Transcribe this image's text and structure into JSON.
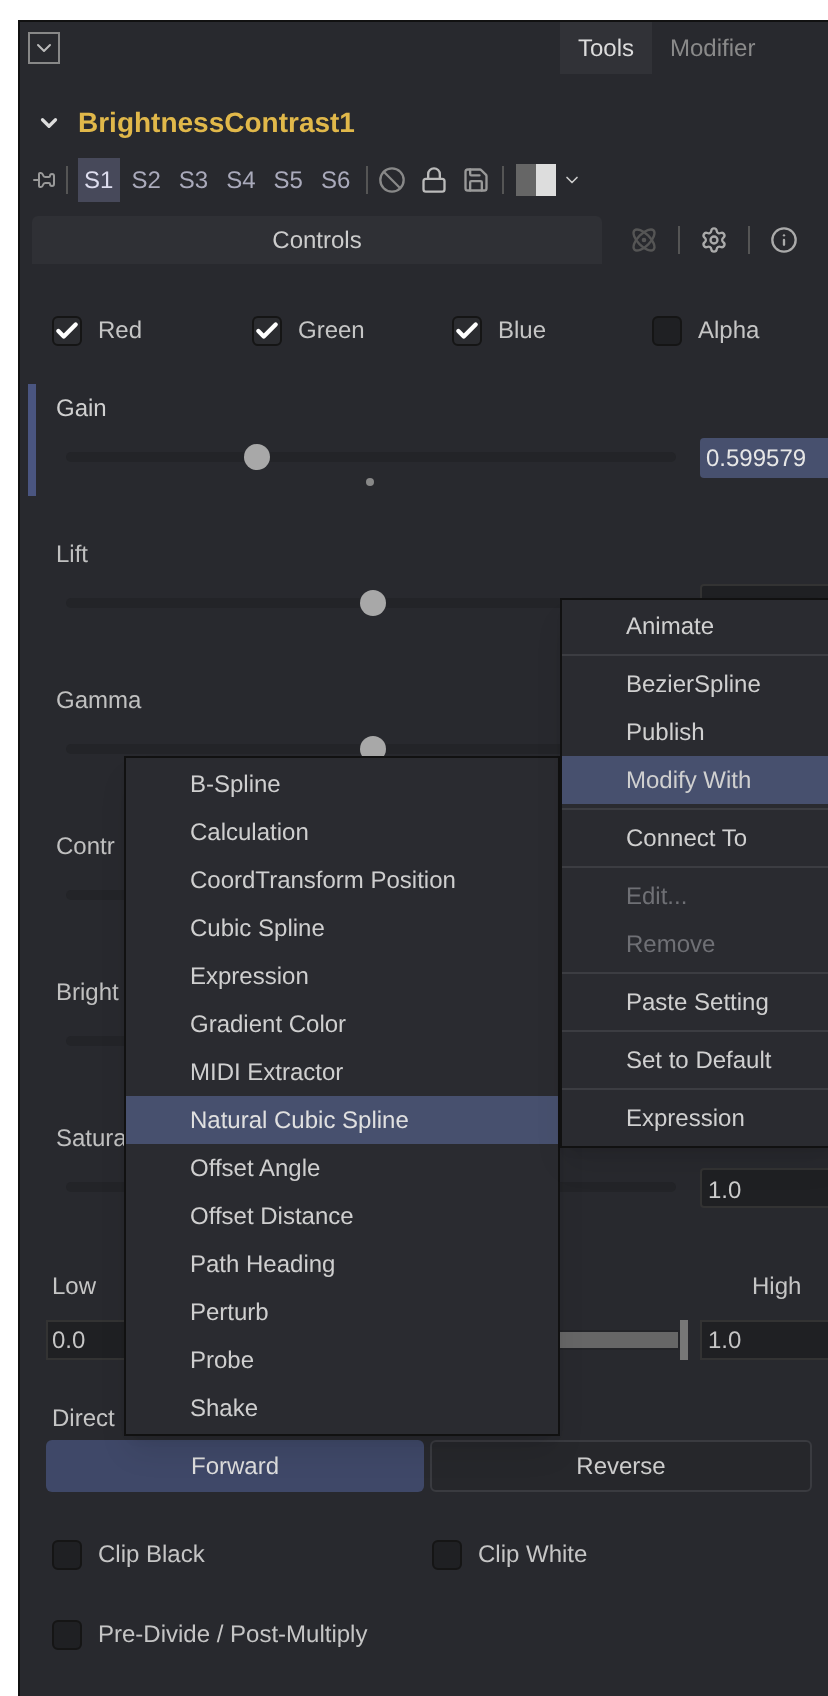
{
  "header": {
    "tabs": [
      {
        "label": "Tools",
        "selected": true
      },
      {
        "label": "Modifier",
        "selected": false
      }
    ]
  },
  "tool": {
    "name": "BrightnessContrast1",
    "expanded": true
  },
  "toolbar": {
    "versions": [
      {
        "label": "S1",
        "selected": true
      },
      {
        "label": "S2",
        "selected": false
      },
      {
        "label": "S3",
        "selected": false
      },
      {
        "label": "S4",
        "selected": false
      },
      {
        "label": "S5",
        "selected": false
      },
      {
        "label": "S6",
        "selected": false
      }
    ]
  },
  "panel_tab": {
    "label": "Controls"
  },
  "channels": [
    {
      "label": "Red",
      "checked": true
    },
    {
      "label": "Green",
      "checked": true
    },
    {
      "label": "Blue",
      "checked": true
    },
    {
      "label": "Alpha",
      "checked": false
    }
  ],
  "sliders": [
    {
      "label": "Gain",
      "level": 0.31,
      "value": "0.599579",
      "active": true
    },
    {
      "label": "Lift",
      "level": 0.5,
      "active": false
    },
    {
      "label": "Gamma",
      "level": 0.5,
      "active": false
    },
    {
      "label": "Contr",
      "active": false
    },
    {
      "label": "Bright",
      "active": false
    },
    {
      "label": "Satura",
      "value": "1.0",
      "active": false
    }
  ],
  "range": {
    "low_label": "Low",
    "high_label": "High",
    "low_value": "0.0",
    "high_value": "1.0",
    "level": 1
  },
  "direction": {
    "label": "Direct",
    "options": [
      {
        "label": "Forward",
        "selected": true
      },
      {
        "label": "Reverse",
        "selected": false
      }
    ]
  },
  "options": [
    {
      "label": "Clip Black",
      "checked": false
    },
    {
      "label": "Clip White",
      "checked": false
    },
    {
      "label": "Pre-Divide / Post-Multiply",
      "checked": false
    }
  ],
  "context_menu": {
    "items": [
      {
        "kind": "item",
        "label": "Animate",
        "disabled": false,
        "selected": false
      },
      {
        "kind": "divider"
      },
      {
        "kind": "item",
        "label": "BezierSpline",
        "disabled": false,
        "selected": false
      },
      {
        "kind": "item",
        "label": "Publish",
        "disabled": false,
        "selected": false
      },
      {
        "kind": "item",
        "label": "Modify With",
        "disabled": false,
        "selected": true
      },
      {
        "kind": "divider"
      },
      {
        "kind": "item",
        "label": "Connect To",
        "disabled": false,
        "selected": false
      },
      {
        "kind": "divider"
      },
      {
        "kind": "item",
        "label": "Edit...",
        "disabled": true,
        "selected": false
      },
      {
        "kind": "item",
        "label": "Remove",
        "disabled": true,
        "selected": false
      },
      {
        "kind": "divider"
      },
      {
        "kind": "item",
        "label": "Paste Setting",
        "disabled": false,
        "selected": false
      },
      {
        "kind": "divider"
      },
      {
        "kind": "item",
        "label": "Set to Default",
        "disabled": false,
        "selected": false
      },
      {
        "kind": "divider"
      },
      {
        "kind": "item",
        "label": "Expression",
        "disabled": false,
        "selected": false
      }
    ]
  },
  "submenu": {
    "items": [
      {
        "label": "B-Spline",
        "selected": false
      },
      {
        "label": "Calculation",
        "selected": false
      },
      {
        "label": "CoordTransform Position",
        "selected": false
      },
      {
        "label": "Cubic Spline",
        "selected": false
      },
      {
        "label": "Expression",
        "selected": false
      },
      {
        "label": "Gradient Color",
        "selected": false
      },
      {
        "label": "MIDI Extractor",
        "selected": false
      },
      {
        "label": "Natural Cubic Spline",
        "selected": true
      },
      {
        "label": "Offset Angle",
        "selected": false
      },
      {
        "label": "Offset Distance",
        "selected": false
      },
      {
        "label": "Path Heading",
        "selected": false
      },
      {
        "label": "Perturb",
        "selected": false
      },
      {
        "label": "Probe",
        "selected": false
      },
      {
        "label": "Shake",
        "selected": false
      }
    ]
  }
}
